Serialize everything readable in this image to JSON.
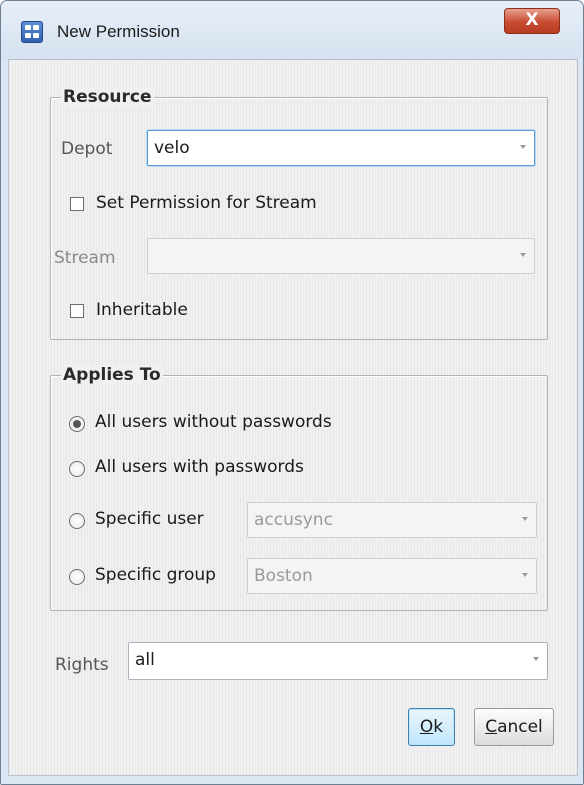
{
  "window": {
    "title": "New Permission",
    "close_glyph": "X",
    "app_icon": "accurev-app-icon"
  },
  "resource": {
    "legend": "Resource",
    "depot_label": "Depot",
    "depot_value": "velo",
    "set_perm_label": "Set Permission for Stream",
    "set_perm_checked": false,
    "stream_label": "Stream",
    "stream_value": "",
    "inheritable_label": "Inheritable",
    "inheritable_checked": false
  },
  "applies_to": {
    "legend": "Applies To",
    "options": [
      {
        "label": "All users without passwords",
        "checked": true
      },
      {
        "label": "All users with passwords",
        "checked": false
      },
      {
        "label": "Specific user",
        "checked": false
      },
      {
        "label": "Specific group",
        "checked": false
      }
    ],
    "specific_user_value": "accusync",
    "specific_group_value": "Boston"
  },
  "rights": {
    "label": "Rights",
    "value": "all"
  },
  "buttons": {
    "ok_mnemonic": "O",
    "ok_rest": "k",
    "cancel_mnemonic": "C",
    "cancel_rest": "ancel"
  }
}
